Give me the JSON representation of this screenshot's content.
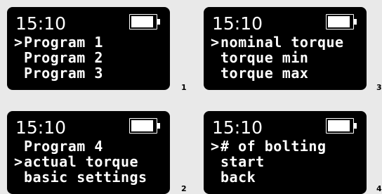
{
  "screens": [
    {
      "time": "15:10",
      "battery_icon": "battery-icon",
      "items": [
        {
          "cursor": ">",
          "label": "Program 1"
        },
        {
          "cursor": "",
          "label": "Program 2"
        },
        {
          "cursor": "",
          "label": "Program 3"
        }
      ],
      "figure_number": "1"
    },
    {
      "time": "15:10",
      "battery_icon": "battery-icon",
      "items": [
        {
          "cursor": "",
          "label": "Program 4"
        },
        {
          "cursor": ">",
          "label": "actual torque"
        },
        {
          "cursor": "",
          "label": "basic settings"
        }
      ],
      "figure_number": "2"
    },
    {
      "time": "15:10",
      "battery_icon": "battery-icon",
      "items": [
        {
          "cursor": ">",
          "label": "nominal torque"
        },
        {
          "cursor": "",
          "label": "torque min"
        },
        {
          "cursor": "",
          "label": "torque max"
        }
      ],
      "figure_number": "3"
    },
    {
      "time": "15:10",
      "battery_icon": "battery-icon",
      "items": [
        {
          "cursor": ">",
          "label": "# of bolting"
        },
        {
          "cursor": "",
          "label": "start"
        },
        {
          "cursor": "",
          "label": "back"
        }
      ],
      "figure_number": "4"
    }
  ]
}
